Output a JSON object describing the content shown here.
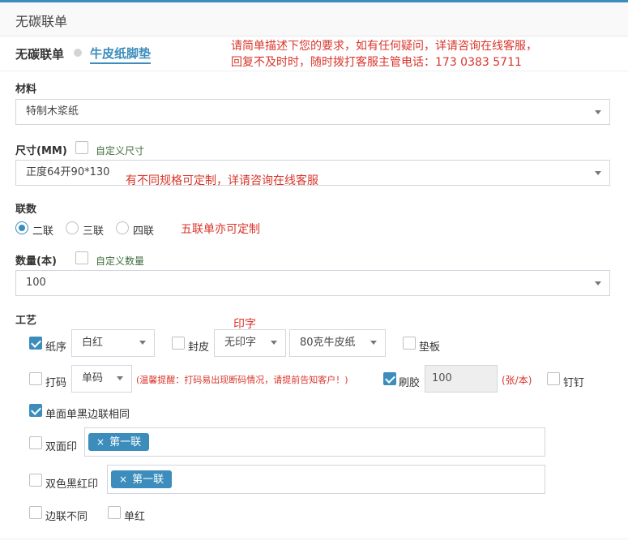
{
  "header": {
    "title": "无碳联单"
  },
  "product": {
    "name": "无碳联单",
    "subtype": "牛皮纸脚垫"
  },
  "notes": {
    "line1": "请简单描述下您的要求，如有任何疑问，详请咨询在线客服，",
    "line2": "回复不及时时，随时拨打客服主管电话：173 0383 5711",
    "size_note": "有不同规格可定制，详请咨询在线客服",
    "copies_note": "五联单亦可定制",
    "print_note": "印字"
  },
  "material": {
    "label": "材料",
    "value": "特制木浆纸"
  },
  "size": {
    "label": "尺寸(MM)",
    "custom_label": "自定义尺寸",
    "value": "正度64开90*130"
  },
  "copies": {
    "label": "联数",
    "options": [
      {
        "label": "二联",
        "selected": true
      },
      {
        "label": "三联",
        "selected": false
      },
      {
        "label": "四联",
        "selected": false
      }
    ]
  },
  "quantity": {
    "label": "数量(本)",
    "custom_label": "自定义数量",
    "value": "100"
  },
  "process": {
    "label": "工艺",
    "paper_order": {
      "label": "纸序",
      "checked": true,
      "value": "白红"
    },
    "cover": {
      "label": "封皮",
      "checked": false,
      "print_value": "无印字",
      "paper_value": "80克牛皮纸"
    },
    "pad": {
      "label": "垫板",
      "checked": false
    },
    "numbering": {
      "label": "打码",
      "checked": false,
      "value": "单码",
      "hint": "(温馨提醒：打码易出现断码情况，请提前告知客户！)"
    },
    "glue": {
      "label": "刷胶",
      "checked": true,
      "value": "100",
      "unit": "(张/本)"
    },
    "staple": {
      "label": "钉钉",
      "checked": false
    },
    "single_black": {
      "label": "单面单黑边联相同",
      "checked": true
    },
    "double_side": {
      "label": "双面印",
      "checked": false,
      "tag": "第一联"
    },
    "two_color": {
      "label": "双色黑红印",
      "checked": false,
      "tag": "第一联"
    },
    "edge_diff": {
      "label": "边联不同",
      "checked": false
    },
    "single_red": {
      "label": "单红",
      "checked": false
    }
  },
  "icons": {
    "caret": "chevron-down-icon",
    "remove": "close-icon",
    "check": "check-icon"
  },
  "colors": {
    "accent": "#3c8dbc",
    "note_red": "#d9352b"
  }
}
